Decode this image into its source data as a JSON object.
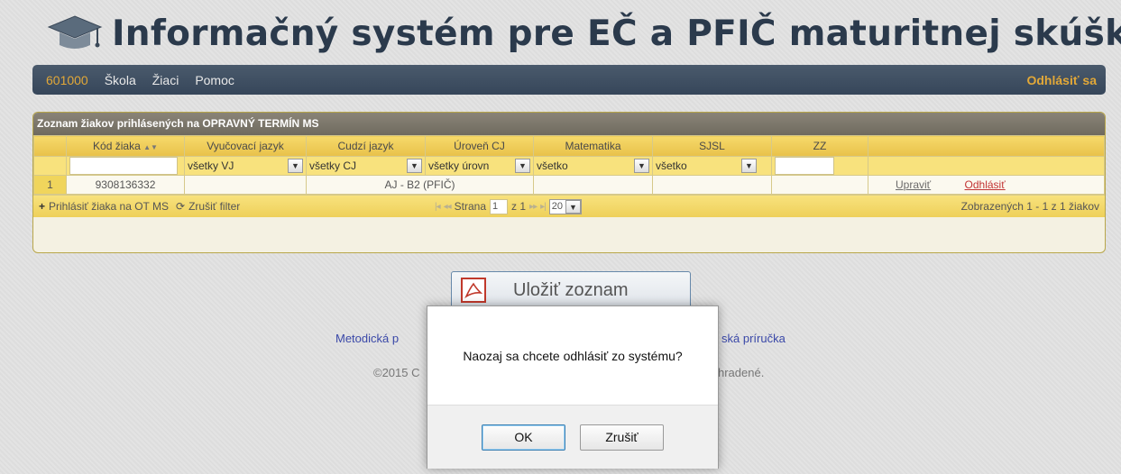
{
  "app": {
    "title": "Informačný systém pre EČ a PFIČ maturitnej skúšky"
  },
  "nav": {
    "code": "601000",
    "items": [
      "Škola",
      "Žiaci",
      "Pomoc"
    ],
    "logout": "Odhlásiť sa"
  },
  "grid": {
    "caption": "Zoznam žiakov prihlásených na OPRAVNÝ TERMÍN MS",
    "columns": [
      "Kód žiaka",
      "Vyučovací jazyk",
      "Cudzí jazyk",
      "Úroveň CJ",
      "Matematika",
      "SJSL",
      "ZZ"
    ],
    "sort_indicator": "▲▼",
    "filters": {
      "vyuc": "všetky VJ",
      "cudzi": "všetky CJ",
      "uroven": "všetky úrovn",
      "mat": "všetko",
      "sjsl": "všetko"
    },
    "rows": [
      {
        "num": "1",
        "code": "9308136332",
        "cj": "AJ - B2 (PFIČ)",
        "edit": "Upraviť",
        "logout": "Odhlásiť"
      }
    ],
    "pager": {
      "add_label": "Prihlásiť žiaka na OT MS",
      "clear_filter": "Zrušiť filter",
      "page_label": "Strana",
      "page_value": "1",
      "page_of": "z 1",
      "page_size": "20",
      "summary": "Zobrazených 1 - 1 z 1 žiakov"
    }
  },
  "pdf_button": {
    "label": "Uložiť zoznam"
  },
  "footer": {
    "link_left": "Metodická p",
    "link_right": "ská príručka",
    "copyright_left": "©2015 C",
    "copyright_right": "hradené."
  },
  "dialog": {
    "message": "Naozaj sa chcete odhlásiť zo systému?",
    "ok": "OK",
    "cancel": "Zrušiť"
  },
  "colors": {
    "nav_bg": "#3e4e62",
    "accent": "#e2a838",
    "grid_header": "#f0d05a",
    "link_logout": "#c23333"
  }
}
